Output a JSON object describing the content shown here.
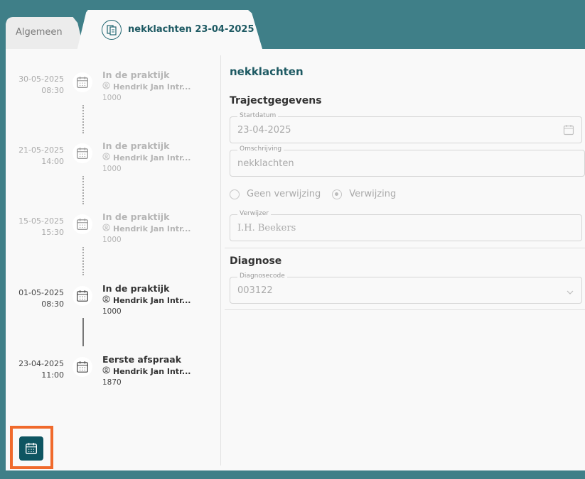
{
  "tabs": {
    "general_label": "Algemeen",
    "active_label": "nekklachten  23-04-2025"
  },
  "timeline": [
    {
      "date": "30-05-2025",
      "time": "08:30",
      "title": "In de praktijk",
      "person": "Hendrik Jan Intr...",
      "code": "1000",
      "muted": true
    },
    {
      "date": "21-05-2025",
      "time": "14:00",
      "title": "In de praktijk",
      "person": "Hendrik Jan Intr...",
      "code": "1000",
      "muted": true
    },
    {
      "date": "15-05-2025",
      "time": "15:30",
      "title": "In de praktijk",
      "person": "Hendrik Jan Intr...",
      "code": "1000",
      "muted": true
    },
    {
      "date": "01-05-2025",
      "time": "08:30",
      "title": "In de praktijk",
      "person": "Hendrik Jan Intr...",
      "code": "1000",
      "muted": false
    },
    {
      "date": "23-04-2025",
      "time": "11:00",
      "title": "Eerste afspraak",
      "person": "Hendrik Jan Intr...",
      "code": "1870",
      "muted": false
    }
  ],
  "form": {
    "title": "nekklachten",
    "section_traject": "Trajectgegevens",
    "startdatum_label": "Startdatum",
    "startdatum_value": "23-04-2025",
    "omschrijving_label": "Omschrijving",
    "omschrijving_value": "nekklachten",
    "radio_geen": "Geen verwijzing",
    "radio_verwijzing": "Verwijzing",
    "verwijzer_label": "Verwijzer",
    "verwijzer_value": "I.H. Beekers",
    "section_diagnose": "Diagnose",
    "diagnosecode_label": "Diagnosecode",
    "diagnosecode_value": "003122"
  },
  "colors": {
    "background": "#3f7f88",
    "accent": "#1e5a63",
    "button": "#0e5561",
    "highlight": "#f06a2c"
  }
}
